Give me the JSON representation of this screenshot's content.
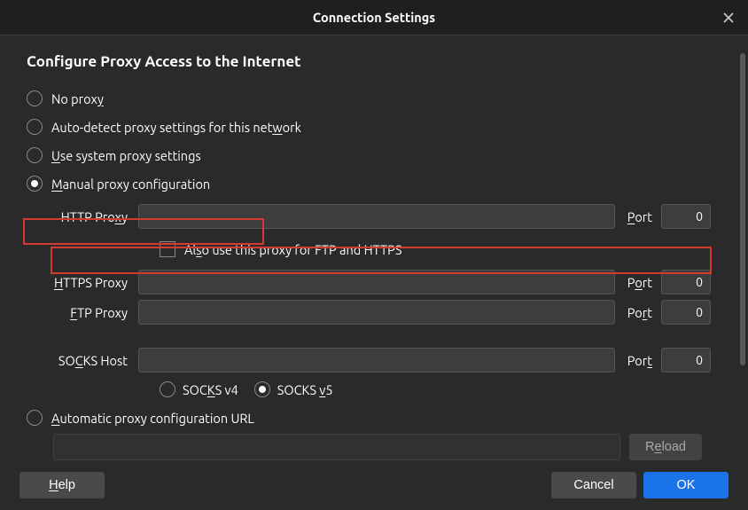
{
  "title": "Connection Settings",
  "section_title": "Configure Proxy Access to the Internet",
  "radios": {
    "no_proxy": {
      "pre": "No prox",
      "u": "y",
      "post": ""
    },
    "auto_detect": {
      "pre": "Auto-detect proxy settings for this net",
      "u": "w",
      "post": "ork"
    },
    "system": {
      "pre": "",
      "u": "U",
      "post": "se system proxy settings"
    },
    "manual": {
      "pre": "",
      "u": "M",
      "post": "anual proxy configuration"
    },
    "auto_url": {
      "pre": "",
      "u": "A",
      "post": "utomatic proxy configuration URL"
    }
  },
  "http": {
    "label_pre": "HTTP Pro",
    "label_u": "x",
    "label_post": "y",
    "port_label_pre": "",
    "port_label_u": "P",
    "port_label_post": "ort",
    "port_value": "0"
  },
  "also_check": {
    "pre": "Al",
    "u": "s",
    "post": "o use this proxy for FTP and HTTPS"
  },
  "https": {
    "label_pre": "",
    "label_u": "H",
    "label_post": "TTPS Proxy",
    "port_label_pre": "P",
    "port_label_u": "o",
    "port_label_post": "rt",
    "port_value": "0"
  },
  "ftp": {
    "label_pre": "",
    "label_u": "F",
    "label_post": "TP Proxy",
    "port_label_pre": "Po",
    "port_label_u": "r",
    "port_label_post": "t",
    "port_value": "0"
  },
  "socks": {
    "label_pre": "SO",
    "label_u": "C",
    "label_post": "KS Host",
    "port_label_pre": "Por",
    "port_label_u": "t",
    "port_label_post": "",
    "port_value": "0"
  },
  "socks_v4": {
    "pre": "SOC",
    "u": "K",
    "post": "S v4"
  },
  "socks_v5": {
    "pre": "SOCKS ",
    "u": "v",
    "post": "5"
  },
  "reload": {
    "pre": "R",
    "u": "e",
    "post": "load"
  },
  "buttons": {
    "help": {
      "pre": "",
      "u": "H",
      "post": "elp"
    },
    "cancel": "Cancel",
    "ok": "OK"
  }
}
